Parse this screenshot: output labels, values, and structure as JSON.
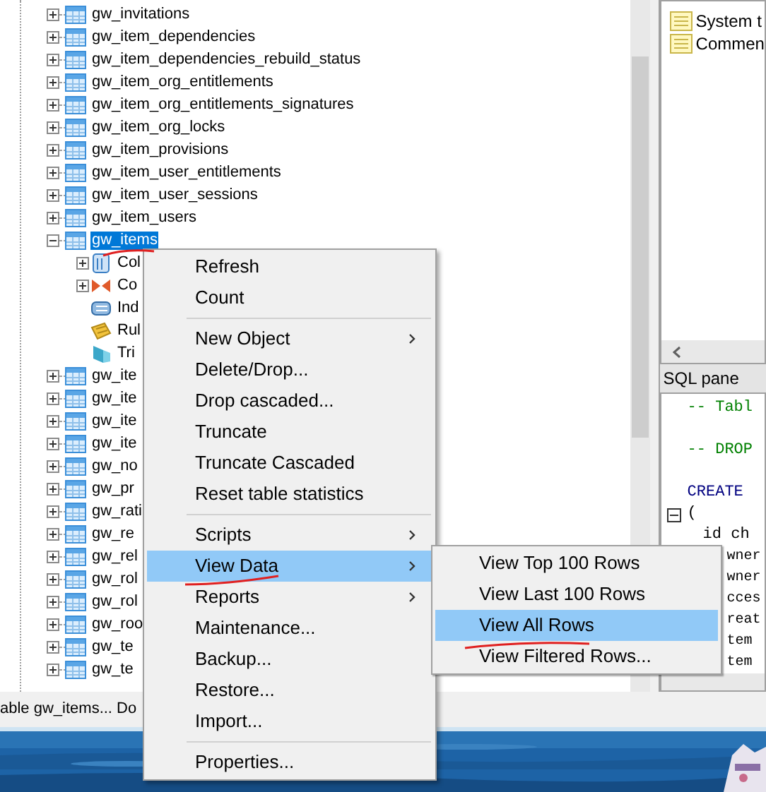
{
  "tree": {
    "items": [
      {
        "label": "gw_invitations",
        "expanded": false,
        "selected": false
      },
      {
        "label": "gw_item_dependencies",
        "expanded": false,
        "selected": false
      },
      {
        "label": "gw_item_dependencies_rebuild_status",
        "expanded": false,
        "selected": false
      },
      {
        "label": "gw_item_org_entitlements",
        "expanded": false,
        "selected": false
      },
      {
        "label": "gw_item_org_entitlements_signatures",
        "expanded": false,
        "selected": false
      },
      {
        "label": "gw_item_org_locks",
        "expanded": false,
        "selected": false
      },
      {
        "label": "gw_item_provisions",
        "expanded": false,
        "selected": false
      },
      {
        "label": "gw_item_user_entitlements",
        "expanded": false,
        "selected": false
      },
      {
        "label": "gw_item_user_sessions",
        "expanded": false,
        "selected": false
      },
      {
        "label": "gw_item_users",
        "expanded": false,
        "selected": false
      },
      {
        "label": "gw_items",
        "expanded": true,
        "selected": true,
        "children": [
          {
            "label": "Col",
            "kind": "columns",
            "expandable": true
          },
          {
            "label": "Co",
            "kind": "constraints",
            "expandable": true
          },
          {
            "label": "Ind",
            "kind": "indexes",
            "expandable": false
          },
          {
            "label": "Rul",
            "kind": "rules",
            "expandable": false
          },
          {
            "label": "Tri",
            "kind": "triggers",
            "expandable": false
          }
        ]
      },
      {
        "label": "gw_ite",
        "expanded": false,
        "selected": false
      },
      {
        "label": "gw_ite",
        "expanded": false,
        "selected": false
      },
      {
        "label": "gw_ite",
        "expanded": false,
        "selected": false
      },
      {
        "label": "gw_ite",
        "expanded": false,
        "selected": false
      },
      {
        "label": "gw_no",
        "expanded": false,
        "selected": false
      },
      {
        "label": "gw_pr",
        "expanded": false,
        "selected": false
      },
      {
        "label": "gw_rati",
        "expanded": false,
        "selected": false
      },
      {
        "label": "gw_re",
        "expanded": false,
        "selected": false
      },
      {
        "label": "gw_rel",
        "expanded": false,
        "selected": false
      },
      {
        "label": "gw_rol",
        "expanded": false,
        "selected": false
      },
      {
        "label": "gw_rol",
        "expanded": false,
        "selected": false
      },
      {
        "label": "gw_roo",
        "expanded": false,
        "selected": false
      },
      {
        "label": "gw_te",
        "expanded": false,
        "selected": false
      },
      {
        "label": "gw_te",
        "expanded": false,
        "selected": false
      }
    ]
  },
  "properties_list": [
    "System t",
    "Commen"
  ],
  "sql_pane": {
    "title": "SQL pane",
    "lines": [
      {
        "text": "-- Tabl",
        "kind": "comment",
        "fold": false
      },
      {
        "kind": "blank",
        "fold": false
      },
      {
        "text": "-- DROP",
        "kind": "comment",
        "fold": false
      },
      {
        "kind": "blank",
        "fold": false
      },
      {
        "text": "CREATE",
        "kind": "keyword",
        "fold": false
      },
      {
        "text": "(",
        "kind": "plain",
        "fold": true
      },
      {
        "text": "id ch",
        "kind": "indented",
        "fold": false
      },
      {
        "text": "wner",
        "kind": "partial",
        "fold": false
      },
      {
        "text": "wner",
        "kind": "partial",
        "fold": false
      },
      {
        "text": "cces",
        "kind": "partial",
        "fold": false
      },
      {
        "text": "reat",
        "kind": "partial",
        "fold": false
      },
      {
        "text": "tem",
        "kind": "partial",
        "fold": false
      },
      {
        "text": "tem",
        "kind": "partial",
        "fold": false
      }
    ]
  },
  "status_bar": "able gw_items... Do",
  "context_menu": {
    "items": [
      {
        "kind": "item",
        "label": "Refresh",
        "submenu": false,
        "selected": false
      },
      {
        "kind": "item",
        "label": "Count",
        "submenu": false,
        "selected": false
      },
      {
        "kind": "separator"
      },
      {
        "kind": "item",
        "label": "New Object",
        "submenu": true,
        "selected": false
      },
      {
        "kind": "item",
        "label": "Delete/Drop...",
        "submenu": false,
        "selected": false
      },
      {
        "kind": "item",
        "label": "Drop cascaded...",
        "submenu": false,
        "selected": false
      },
      {
        "kind": "item",
        "label": "Truncate",
        "submenu": false,
        "selected": false
      },
      {
        "kind": "item",
        "label": "Truncate Cascaded",
        "submenu": false,
        "selected": false
      },
      {
        "kind": "item",
        "label": "Reset table statistics",
        "submenu": false,
        "selected": false
      },
      {
        "kind": "separator"
      },
      {
        "kind": "item",
        "label": "Scripts",
        "submenu": true,
        "selected": false
      },
      {
        "kind": "item",
        "label": "View Data",
        "submenu": true,
        "selected": true
      },
      {
        "kind": "item",
        "label": "Reports",
        "submenu": true,
        "selected": false
      },
      {
        "kind": "item",
        "label": "Maintenance...",
        "submenu": false,
        "selected": false
      },
      {
        "kind": "item",
        "label": "Backup...",
        "submenu": false,
        "selected": false
      },
      {
        "kind": "item",
        "label": "Restore...",
        "submenu": false,
        "selected": false
      },
      {
        "kind": "item",
        "label": "Import...",
        "submenu": false,
        "selected": false
      },
      {
        "kind": "separator"
      },
      {
        "kind": "item",
        "label": "Properties...",
        "submenu": false,
        "selected": false
      }
    ]
  },
  "submenu": {
    "items": [
      {
        "label": "View Top 100 Rows",
        "selected": false
      },
      {
        "label": "View Last 100 Rows",
        "selected": false
      },
      {
        "label": "View All Rows",
        "selected": true
      },
      {
        "label": "View Filtered Rows...",
        "selected": false
      }
    ]
  }
}
